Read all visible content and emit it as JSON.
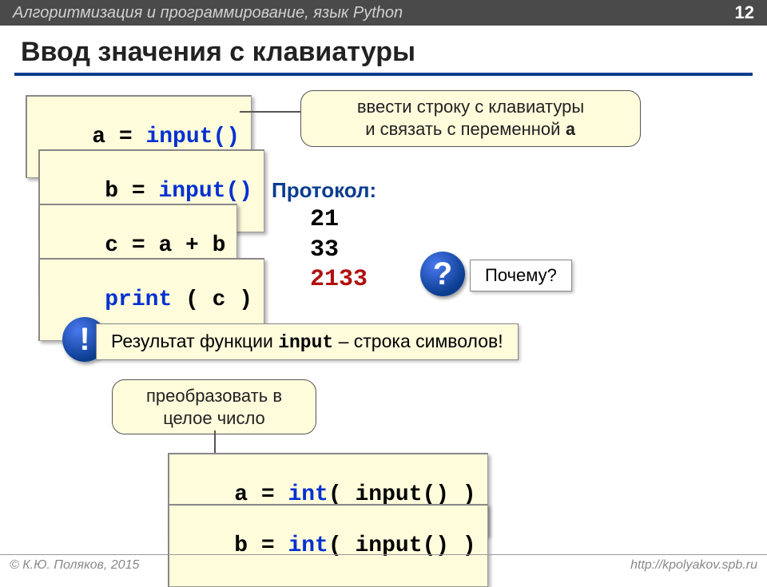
{
  "header": {
    "title": "Алгоритмизация и программирование, язык Python",
    "page": "12"
  },
  "slide_title": "Ввод значения с клавиатуры",
  "code": {
    "line1_var": "a",
    "line1_eq": " = ",
    "line1_kw": "input()",
    "line2_var": "b",
    "line2_eq": " = ",
    "line2_kw": "input()",
    "line3_var": "c",
    "line3_eq": " = ",
    "line3_rhs": "a + b",
    "line4_kw": "print",
    "line4_rest": " ( c )",
    "line5_var": "a",
    "line5_eq": " = ",
    "line5_kw": "int",
    "line5_rest": "( input() )",
    "line6_var": "b",
    "line6_eq": " = ",
    "line6_kw": "int",
    "line6_rest": "( input() )"
  },
  "callout_top": {
    "line1": "ввести строку с клавиатуры",
    "line2_a": "и связать с переменной ",
    "line2_b": "a"
  },
  "protocol": {
    "label": "Протокол:",
    "v1": "21",
    "v2": "33",
    "v3": "2133"
  },
  "question": {
    "mark": "?",
    "text": "Почему?"
  },
  "result": {
    "mark": "!",
    "t1": "Результат функции ",
    "mono": "input",
    "t2": " – строка символов!"
  },
  "callout_bottom": {
    "line1": "преобразовать в",
    "line2": "целое число"
  },
  "footer": {
    "author": "© К.Ю. Поляков, 2015",
    "url": "http://kpolyakov.spb.ru"
  }
}
